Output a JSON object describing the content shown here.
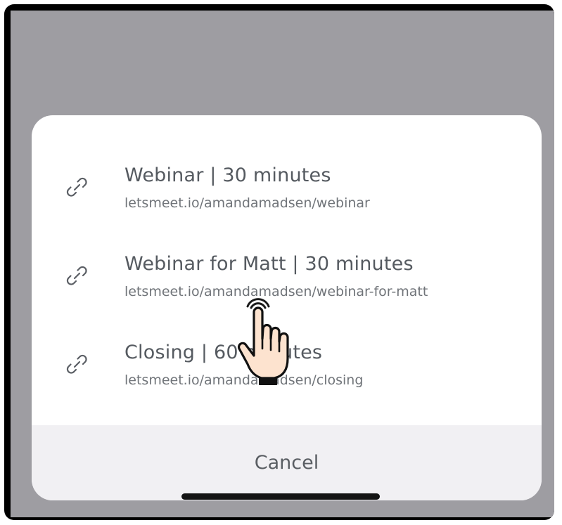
{
  "sheet": {
    "items": [
      {
        "title": "Webinar | 30 minutes",
        "url": "letsmeet.io/amandamadsen/webinar",
        "icon": "link-icon"
      },
      {
        "title": "Webinar for Matt | 30 minutes",
        "url": "letsmeet.io/amandamadsen/webinar-for-matt",
        "icon": "link-icon"
      },
      {
        "title": "Closing | 60 minutes",
        "url": "letsmeet.io/amandamadsen/closing",
        "icon": "link-icon"
      }
    ],
    "cancel_label": "Cancel"
  },
  "overlay": {
    "cursor_icon": "hand-pointer-icon"
  },
  "colors": {
    "backdrop": "#9e9da2",
    "sheet": "#ffffff",
    "cancel_bg": "#f1f0f3",
    "text": "#555a60"
  }
}
